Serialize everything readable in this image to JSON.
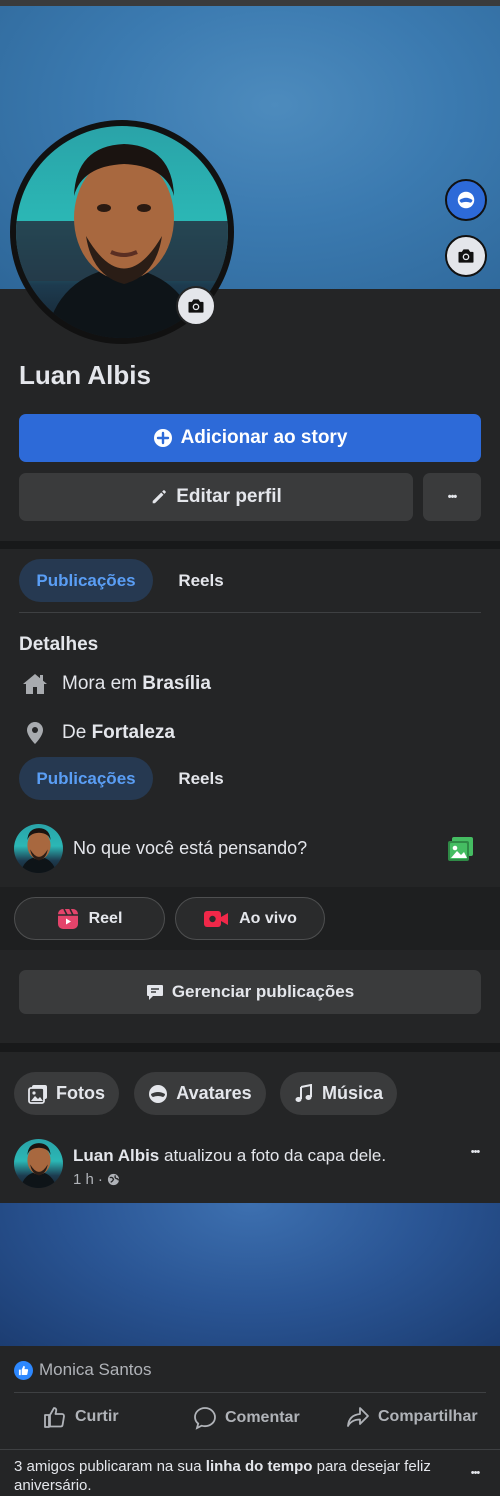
{
  "profile": {
    "name": "Luan Albis"
  },
  "buttons": {
    "add_story": "Adicionar ao story",
    "edit_profile": "Editar perfil",
    "more": "•••"
  },
  "tabs": [
    {
      "label": "Publicações",
      "active": true
    },
    {
      "label": "Reels",
      "active": false
    }
  ],
  "details": {
    "title": "Detalhes",
    "lives_in_prefix": "Mora em",
    "lives_in_city": "Brasília",
    "from_prefix": "De",
    "from_city": "Fortaleza"
  },
  "composer": {
    "placeholder": "No que você está pensando?"
  },
  "quick_actions": {
    "reel": "Reel",
    "live": "Ao vivo"
  },
  "manage": {
    "label": "Gerenciar publicações"
  },
  "chips": {
    "photos": "Fotos",
    "avatars": "Avatares",
    "music": "Música"
  },
  "post": {
    "author": "Luan Albis",
    "action_text": "atualizou a foto da capa dele.",
    "time": "1 h",
    "separator": "·",
    "reactor": "Monica Santos",
    "actions": {
      "like": "Curtir",
      "comment": "Comentar",
      "share": "Compartilhar"
    }
  },
  "notice": {
    "part1": "3 amigos publicaram na sua",
    "link": "linha do tempo",
    "part2": "para desejar feliz aniversário."
  },
  "colors": {
    "background": "#18191a",
    "card": "#242526",
    "primary": "#2d6ad8",
    "tab_active_bg": "#263951",
    "tab_active_text": "#5a9ef5",
    "reel_icon": "#e4446b",
    "live_icon": "#f02849",
    "photo_icon": "#45bd62"
  }
}
